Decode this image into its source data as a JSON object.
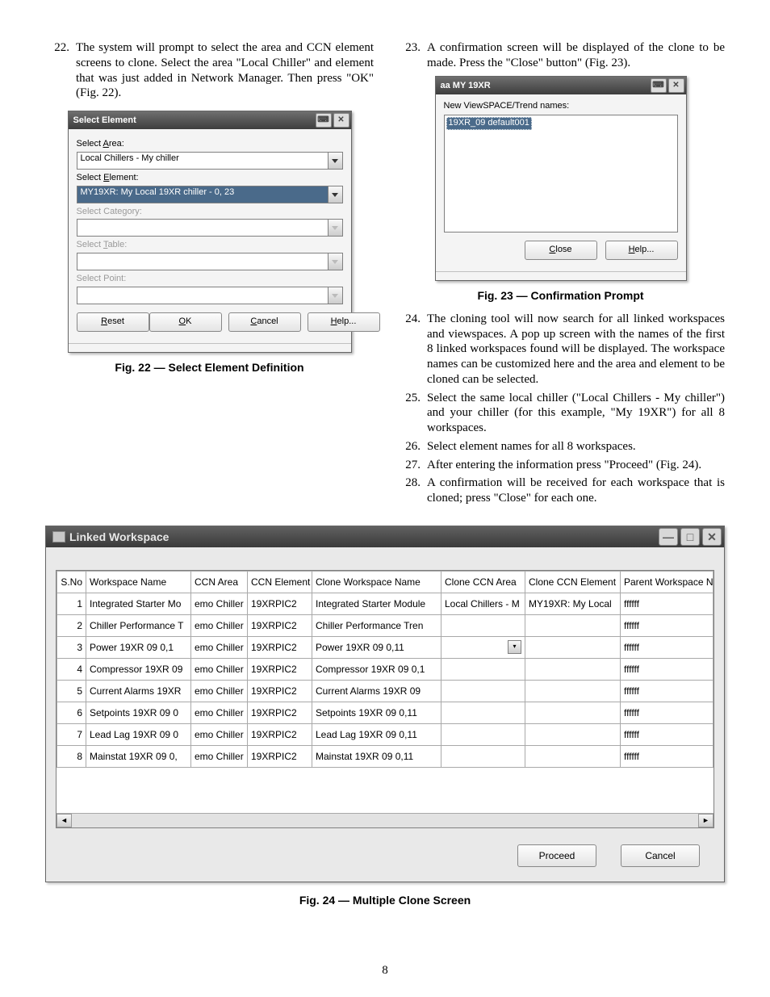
{
  "steps_left": [
    {
      "n": "22.",
      "t": "The system will prompt to select the area and CCN element screens to clone. Select the area \"Local Chiller\" and element that was just added in Network Manager. Then press \"OK\" (Fig. 22)."
    }
  ],
  "steps_right": [
    {
      "n": "23.",
      "t": "A confirmation screen will be displayed of the clone to be made. Press the \"Close\" button\" (Fig. 23)."
    },
    {
      "n": "24.",
      "t": "The cloning tool will now search for all linked workspaces and viewspaces. A pop up screen with the names of the first 8 linked workspaces found will be displayed. The workspace names can be customized here and the area and element to be cloned can be selected."
    },
    {
      "n": "25.",
      "t": "Select the same local chiller (\"Local Chillers - My chiller\") and your chiller (for this example, \"My 19XR\") for all 8 workspaces."
    },
    {
      "n": "26.",
      "t": "Select element names for all 8 workspaces."
    },
    {
      "n": "27.",
      "t": "After entering the information press \"Proceed\" (Fig. 24)."
    },
    {
      "n": "28.",
      "t": "A confirmation will be received for each workspace that is cloned; press \"Close\" for each one."
    }
  ],
  "fig22": {
    "title": "Select Element",
    "labels": {
      "area_pre": "Select ",
      "area_u": "A",
      "area_post": "rea:",
      "el_pre": "Select ",
      "el_u": "E",
      "el_post": "lement:",
      "cat": "Select Category:",
      "tbl_pre": "Select ",
      "tbl_u": "T",
      "tbl_post": "able:",
      "pt": "Select Point:"
    },
    "area_value": "Local Chillers - My chiller",
    "element_value": "MY19XR: My Local 19XR chiller - 0, 23",
    "buttons": {
      "reset_u": "R",
      "reset": "eset",
      "ok_u": "O",
      "ok": "K",
      "cancel_u": "C",
      "cancel": "ancel",
      "help_u": "H",
      "help": "elp..."
    },
    "caption": "Fig. 22 — Select Element Definition"
  },
  "fig23": {
    "title": "aa MY 19XR",
    "label": "New ViewSPACE/Trend names:",
    "item": "19XR_09 default001",
    "close_u": "C",
    "close": "lose",
    "help_u": "H",
    "help": "elp...",
    "caption": "Fig. 23 — Confirmation Prompt"
  },
  "fig24": {
    "title": "Linked Workspace",
    "headers": [
      "S.No",
      "Workspace Name",
      "CCN Area",
      "CCN Element",
      "Clone Workspace Name",
      "Clone CCN Area",
      "Clone CCN Element",
      "Parent Workspace Name"
    ],
    "rows": [
      {
        "n": "1",
        "ws": "Integrated Starter Mo",
        "area": "emo Chiller",
        "el": "19XRPIC2",
        "cws": "Integrated Starter Module",
        "carea": "Local Chillers - M",
        "cel": "MY19XR: My Local",
        "pw": "ffffff"
      },
      {
        "n": "2",
        "ws": "Chiller Performance T",
        "area": "emo Chiller",
        "el": "19XRPIC2",
        "cws": "Chiller Performance Tren",
        "carea": "",
        "cel": "",
        "pw": "ffffff"
      },
      {
        "n": "3",
        "ws": "Power 19XR 09 0,1",
        "area": "emo Chiller",
        "el": "19XRPIC2",
        "cws": "Power 19XR 09 0,11",
        "carea": "__dd__",
        "cel": "",
        "pw": "ffffff"
      },
      {
        "n": "4",
        "ws": "Compressor 19XR 09",
        "area": "emo Chiller",
        "el": "19XRPIC2",
        "cws": "Compressor 19XR 09 0,1",
        "carea": "",
        "cel": "",
        "pw": "ffffff"
      },
      {
        "n": "5",
        "ws": "Current Alarms 19XR",
        "area": "emo Chiller",
        "el": "19XRPIC2",
        "cws": "Current Alarms 19XR 09",
        "carea": "",
        "cel": "",
        "pw": "ffffff"
      },
      {
        "n": "6",
        "ws": "Setpoints 19XR 09 0",
        "area": "emo Chiller",
        "el": "19XRPIC2",
        "cws": "Setpoints 19XR 09 0,11",
        "carea": "",
        "cel": "",
        "pw": "ffffff"
      },
      {
        "n": "7",
        "ws": "Lead Lag 19XR 09 0",
        "area": "emo Chiller",
        "el": "19XRPIC2",
        "cws": "Lead Lag 19XR 09 0,11",
        "carea": "",
        "cel": "",
        "pw": "ffffff"
      },
      {
        "n": "8",
        "ws": "Mainstat 19XR 09 0,",
        "area": "emo Chiller",
        "el": "19XRPIC2",
        "cws": "Mainstat 19XR 09 0,11",
        "carea": "",
        "cel": "",
        "pw": "ffffff"
      }
    ],
    "proceed": "Proceed",
    "cancel": "Cancel",
    "caption": "Fig. 24 — Multiple Clone Screen"
  },
  "pagenum": "8"
}
